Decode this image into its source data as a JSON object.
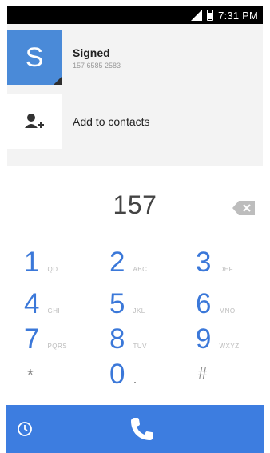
{
  "status_bar": {
    "time": "7:31 PM",
    "icons": [
      "signal-icon",
      "battery-icon"
    ]
  },
  "suggestions": [
    {
      "avatar_letter": "S",
      "name": "Signed",
      "number": "157 6585 2583"
    },
    {
      "label": "Add to contacts",
      "icon": "add-contact-icon"
    }
  ],
  "dial": {
    "digits": "157"
  },
  "keypad": [
    {
      "num": "1",
      "letters": "QD"
    },
    {
      "num": "2",
      "letters": "ABC"
    },
    {
      "num": "3",
      "letters": "DEF"
    },
    {
      "num": "4",
      "letters": "GHI"
    },
    {
      "num": "5",
      "letters": "JKL"
    },
    {
      "num": "6",
      "letters": "MNO"
    },
    {
      "num": "7",
      "letters": "PQRS"
    },
    {
      "num": "8",
      "letters": "TUV"
    },
    {
      "num": "9",
      "letters": "WXYZ"
    },
    {
      "num": "*",
      "letters": ""
    },
    {
      "num": "0",
      "letters": "."
    },
    {
      "num": "#",
      "letters": ""
    }
  ],
  "colors": {
    "accent": "#3d7de0",
    "digits_text": "#444444"
  }
}
